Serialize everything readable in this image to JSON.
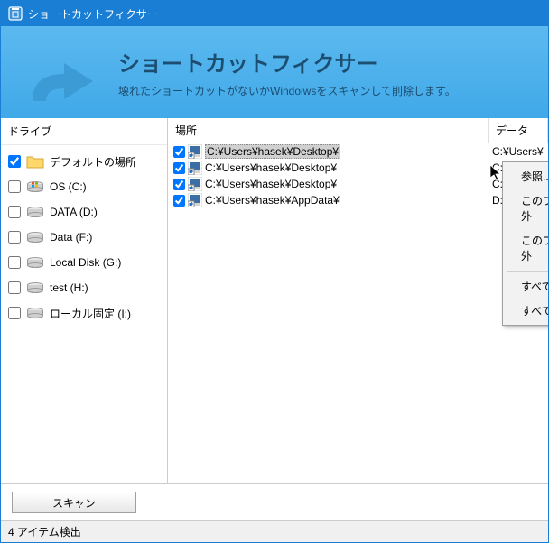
{
  "window": {
    "title": "ショートカットフィクサー"
  },
  "banner": {
    "heading": "ショートカットフィクサー",
    "subheading": "壊れたショートカットがないかWindoiwsをスキャンして削除します。"
  },
  "leftPane": {
    "header": "ドライブ",
    "drives": [
      {
        "checked": true,
        "label": "デフォルトの場所",
        "iconType": "folder"
      },
      {
        "checked": false,
        "label": "OS (C:)",
        "iconType": "windrive"
      },
      {
        "checked": false,
        "label": "DATA (D:)",
        "iconType": "drive"
      },
      {
        "checked": false,
        "label": "Data (F:)",
        "iconType": "drive"
      },
      {
        "checked": false,
        "label": "Local Disk (G:)",
        "iconType": "drive"
      },
      {
        "checked": false,
        "label": "test (H:)",
        "iconType": "drive"
      },
      {
        "checked": false,
        "label": "ローカル固定 (I:)",
        "iconType": "drive"
      }
    ]
  },
  "rightPane": {
    "columns": {
      "location": "場所",
      "data": "データ"
    },
    "rows": [
      {
        "checked": true,
        "selected": true,
        "location": "C:¥Users¥hasek¥Desktop¥",
        "data": "C:¥Users¥"
      },
      {
        "checked": true,
        "selected": false,
        "location": "C:¥Users¥hasek¥Desktop¥",
        "data": "C:¥Users¥"
      },
      {
        "checked": true,
        "selected": false,
        "location": "C:¥Users¥hasek¥Desktop¥",
        "data": "C:¥WINDO"
      },
      {
        "checked": true,
        "selected": false,
        "location": "C:¥Users¥hasek¥AppData¥",
        "data": "D:¥downlo"
      }
    ]
  },
  "contextMenu": {
    "items": [
      {
        "label": "参照..."
      },
      {
        "label": "このファイルを除外"
      },
      {
        "label": "このフォルダを除外"
      },
      {
        "separator": true
      },
      {
        "label": "すべて選択"
      },
      {
        "label": "すべて選択解除"
      }
    ]
  },
  "footer": {
    "scanButton": "スキャン",
    "status": "4 アイテム検出"
  }
}
